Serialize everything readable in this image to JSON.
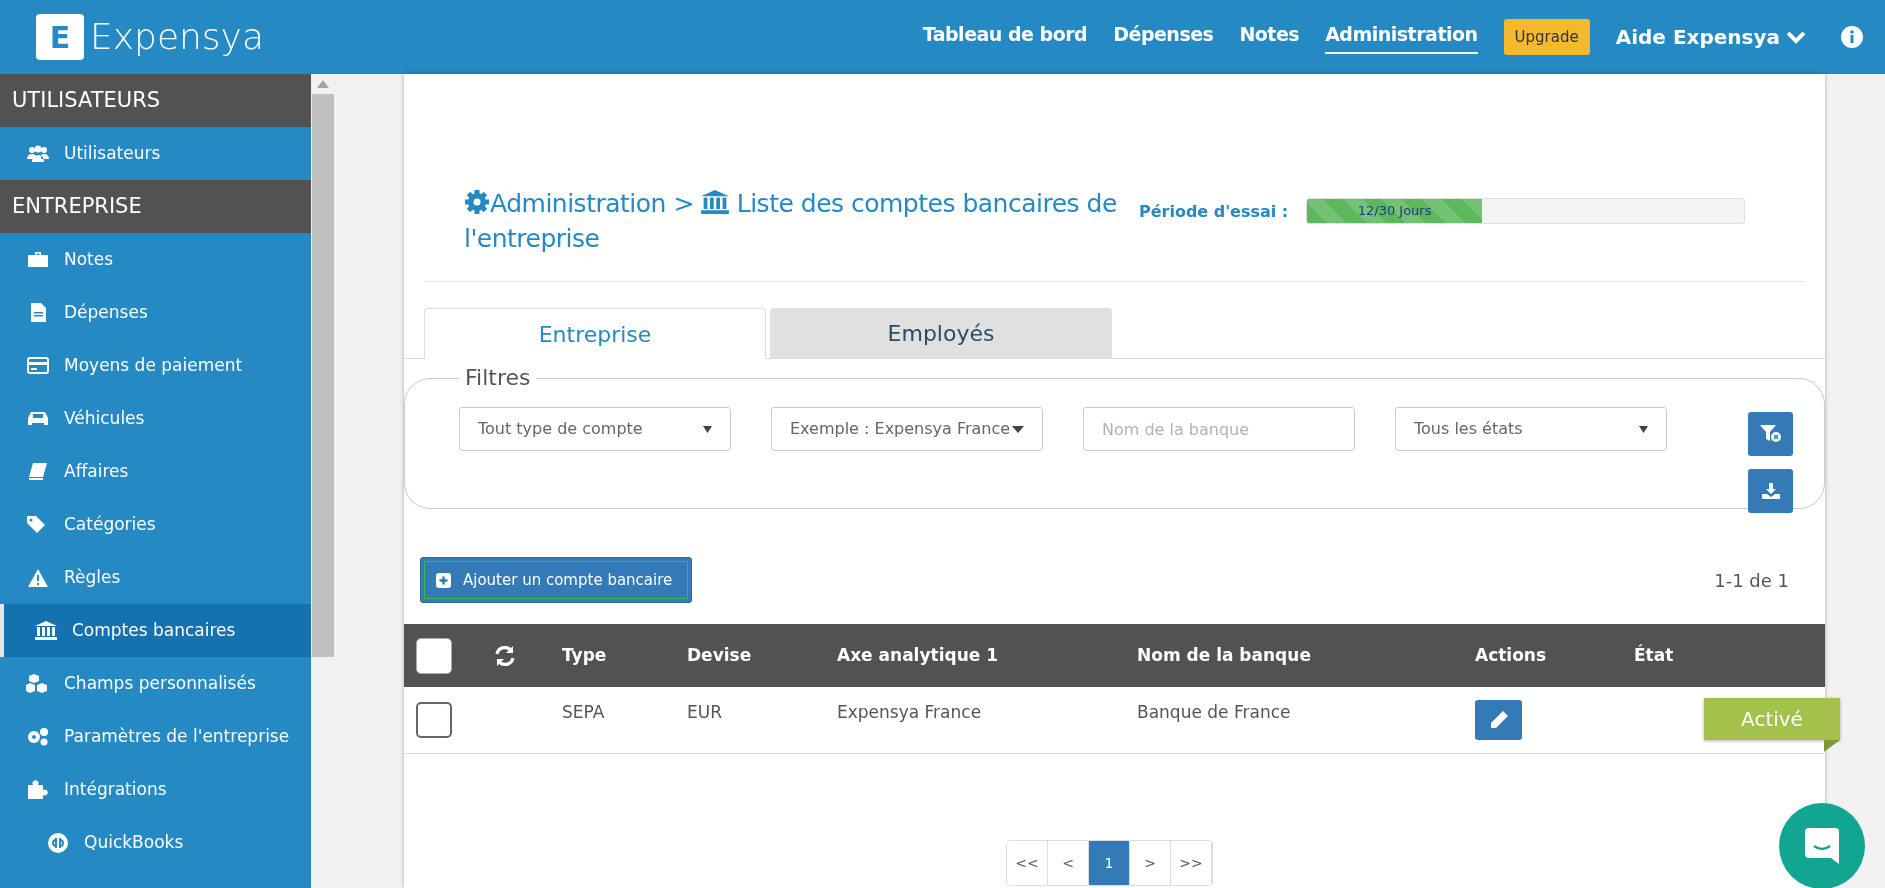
{
  "app": {
    "logo_letter": "E",
    "name": "Expensya"
  },
  "nav": [
    {
      "label": "Tableau de bord",
      "selected": false,
      "kind": "link"
    },
    {
      "label": "Dépenses",
      "selected": false,
      "kind": "link"
    },
    {
      "label": "Notes",
      "selected": false,
      "kind": "link"
    },
    {
      "label": "Administration",
      "selected": true,
      "kind": "link"
    },
    {
      "label": "Upgrade",
      "selected": false,
      "kind": "badge"
    },
    {
      "label": "Aide Expensya",
      "selected": false,
      "kind": "menu"
    }
  ],
  "sidebar": {
    "sections": [
      {
        "title": "UTILISATEURS",
        "items": [
          {
            "label": "Utilisateurs",
            "selected": false,
            "kind": "item"
          }
        ]
      },
      {
        "title": "ENTREPRISE",
        "items": [
          {
            "label": "Notes",
            "selected": false,
            "kind": "item"
          },
          {
            "label": "Dépenses",
            "selected": false,
            "kind": "item"
          },
          {
            "label": "Moyens de paiement",
            "selected": false,
            "kind": "item"
          },
          {
            "label": "Véhicules",
            "selected": false,
            "kind": "item"
          },
          {
            "label": "Affaires",
            "selected": false,
            "kind": "item"
          },
          {
            "label": "Catégories",
            "selected": false,
            "kind": "item"
          },
          {
            "label": "Règles",
            "selected": false,
            "kind": "item"
          },
          {
            "label": "Comptes bancaires",
            "selected": true,
            "kind": "item"
          },
          {
            "label": "Champs personnalisés",
            "selected": false,
            "kind": "item"
          },
          {
            "label": "Paramètres de l'entreprise",
            "selected": false,
            "kind": "item"
          },
          {
            "label": "Intégrations",
            "selected": false,
            "kind": "item"
          },
          {
            "label": "QuickBooks",
            "selected": false,
            "kind": "subitem"
          }
        ]
      }
    ]
  },
  "header": {
    "crumb": "Administration >",
    "title": "Liste des comptes bancaires de l'entreprise",
    "trial_label": "Période d'essai :",
    "trial": {
      "reading": "12/30 Jours",
      "level": 0.4
    }
  },
  "tabs": [
    {
      "label": "Entreprise",
      "selected": true
    },
    {
      "label": "Employés",
      "selected": false
    }
  ],
  "filters": {
    "legend": "Filtres",
    "fields": [
      {
        "kind": "select",
        "value": "Tout type de compte"
      },
      {
        "kind": "combo",
        "value": "Exemple : Expensya France"
      },
      {
        "kind": "input",
        "placeholder": "Nom de la banque"
      },
      {
        "kind": "select",
        "value": "Tous les états"
      }
    ]
  },
  "add_button": "Ajouter un compte bancaire",
  "count": "1-1 de 1",
  "table": {
    "all_checked": false,
    "columns": [
      "Type",
      "Devise",
      "Axe analytique 1",
      "Nom de la banque",
      "Actions",
      "État"
    ],
    "rows": [
      {
        "checked": false,
        "type": "SEPA",
        "currency": "EUR",
        "axis": "Expensya France",
        "bank": "Banque de France",
        "status": "Activé"
      }
    ]
  },
  "pagination": [
    {
      "label": "<<",
      "selected": false
    },
    {
      "label": "<",
      "selected": false
    },
    {
      "label": "1",
      "selected": true
    },
    {
      "label": ">",
      "selected": false
    },
    {
      "label": ">>",
      "selected": false
    }
  ]
}
